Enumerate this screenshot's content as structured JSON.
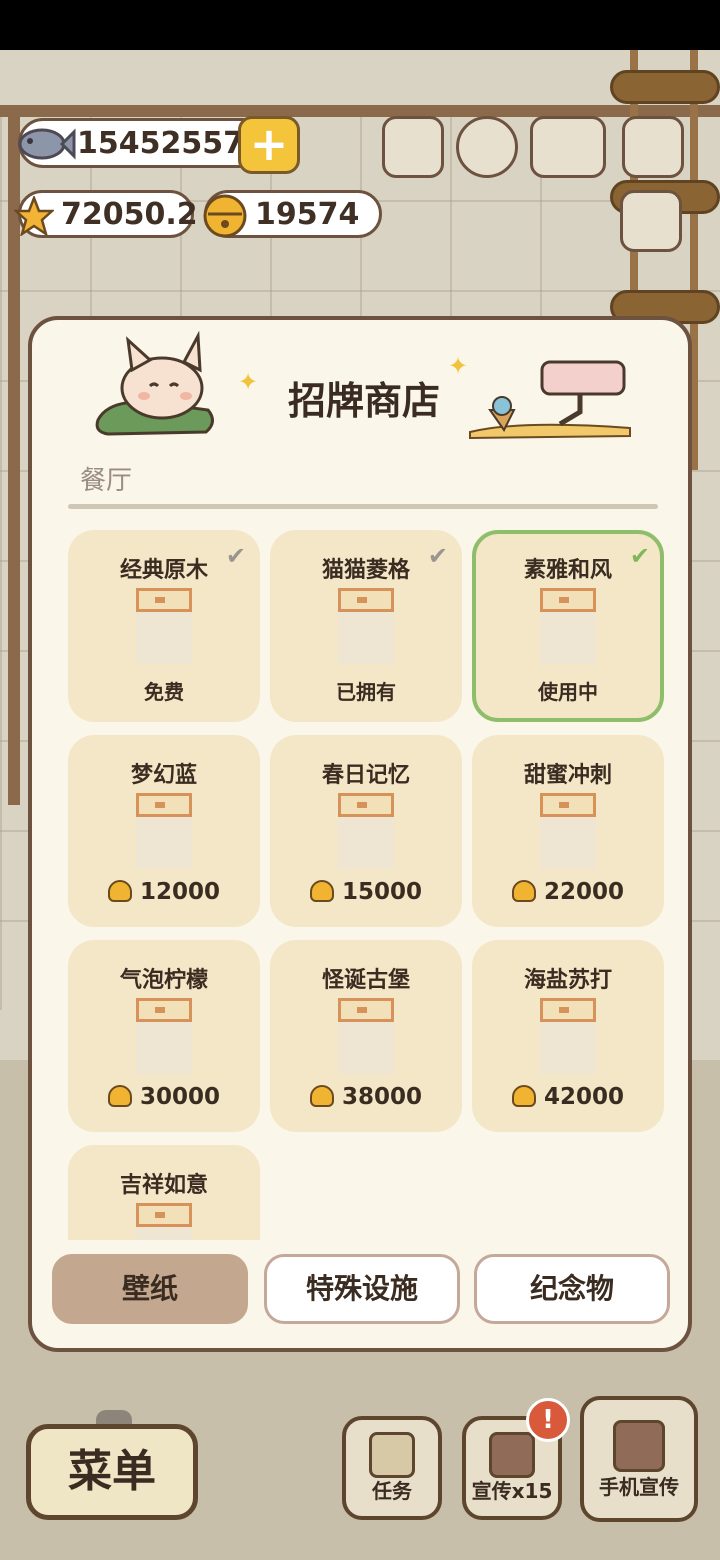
{
  "hud": {
    "fish": "15452557",
    "stars": "72050.2",
    "bells": "19574",
    "plus": "+"
  },
  "modal": {
    "title": "招牌商店",
    "category": "餐厅",
    "items": [
      {
        "name": "经典原木",
        "status": "免费",
        "owned": true
      },
      {
        "name": "猫猫菱格",
        "status": "已拥有",
        "owned": true
      },
      {
        "name": "素雅和风",
        "status": "使用中",
        "owned": true,
        "active": true
      },
      {
        "name": "梦幻蓝",
        "price": "12000"
      },
      {
        "name": "春日记忆",
        "price": "15000"
      },
      {
        "name": "甜蜜冲刺",
        "price": "22000"
      },
      {
        "name": "气泡柠檬",
        "price": "30000"
      },
      {
        "name": "怪诞古堡",
        "price": "38000"
      },
      {
        "name": "海盐苏打",
        "price": "42000"
      },
      {
        "name": "吉祥如意"
      }
    ],
    "tabs": [
      "壁纸",
      "特殊设施",
      "纪念物"
    ]
  },
  "bottom": {
    "menu": "菜单",
    "tasks": "任务",
    "promote": "宣传x15",
    "phone_promote": "手机宣传",
    "alert": "!"
  },
  "colors": {
    "accent_yellow": "#f4c43b",
    "active_green": "#8fbe6a",
    "card_bg": "#f4e7c8",
    "tab_selected": "#c3a88f"
  }
}
